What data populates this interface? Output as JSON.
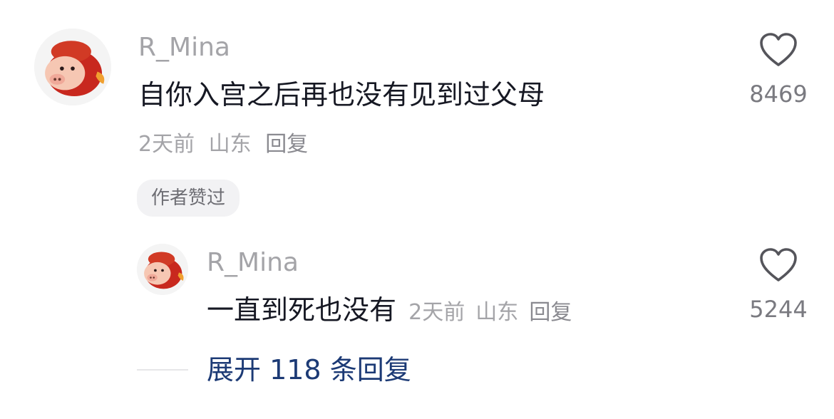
{
  "comment": {
    "avatar_icon": "pig-character-avatar",
    "username": "R_Mina",
    "text": "自你入宫之后再也没有见到过父母",
    "time": "2天前",
    "location": "山东",
    "reply_label": "回复",
    "author_badge": "作者赞过",
    "like_icon": "heart-outline-icon",
    "like_count": "8469"
  },
  "reply": {
    "avatar_icon": "pig-character-avatar",
    "username": "R_Mina",
    "text": "一直到死也没有",
    "time": "2天前",
    "location": "山东",
    "reply_label": "回复",
    "like_icon": "heart-outline-icon",
    "like_count": "5244"
  },
  "expand": {
    "label": "展开 118 条回复"
  },
  "colors": {
    "text_primary": "#161823",
    "text_secondary": "#a4a4a8",
    "link_blue": "#1c3a75",
    "badge_bg": "#f2f2f4"
  }
}
